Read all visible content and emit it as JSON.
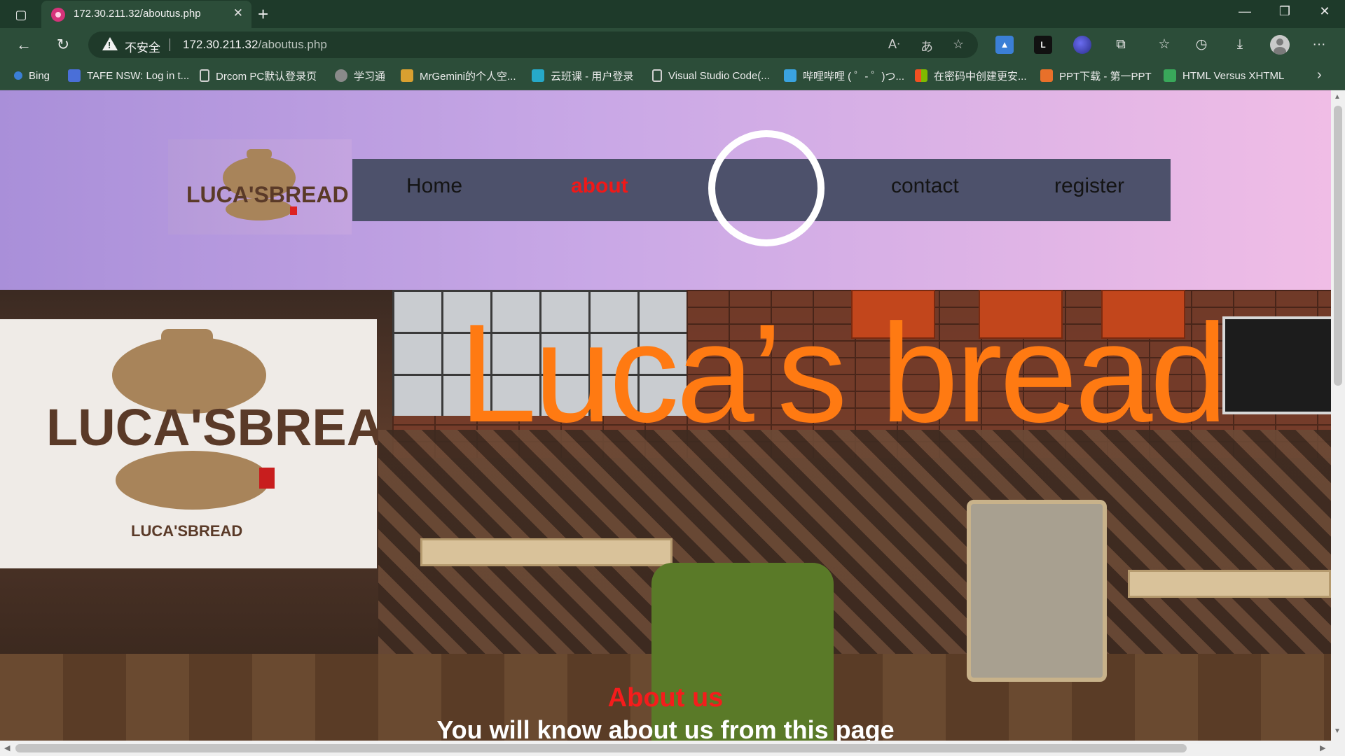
{
  "browser": {
    "tab": {
      "title": "172.30.211.32/aboutus.php",
      "close": "✕"
    },
    "new_tab": "+",
    "window_controls": {
      "minimize": "—",
      "restore": "❐",
      "close": "✕"
    },
    "toolbar": {
      "back": "←",
      "reload": "↻",
      "security_label": "不安全",
      "url_host": "172.30.211.32",
      "url_path": "/aboutus.php",
      "read_aloud": "A͏ᐧ",
      "translate": "あ",
      "favorite_add": "☆",
      "ext_dark_label": "L",
      "more": "···"
    },
    "bookmarks": [
      {
        "label": "Bing",
        "icon": "search-icon",
        "color": "#3b7fd6"
      },
      {
        "label": "TAFE NSW: Log in t...",
        "icon": "tafe-icon",
        "color": "#4a6fd8"
      },
      {
        "label": "Drcom PC默认登录页",
        "icon": "page-icon",
        "color": "#cfcfcf"
      },
      {
        "label": "学习通",
        "icon": "globe-icon",
        "color": "#8a8a8a"
      },
      {
        "label": "MrGemini的个人空...",
        "icon": "shield-icon",
        "color": "#d9a030"
      },
      {
        "label": "云班课 - 用户登录",
        "icon": "cloud-icon",
        "color": "#26a9c9"
      },
      {
        "label": "Visual Studio Code(...",
        "icon": "page-icon",
        "color": "#cfcfcf"
      },
      {
        "label": "哔哩哔哩 ( ゜- ゜)つ...",
        "icon": "bilibili-icon",
        "color": "#3aa3e0"
      },
      {
        "label": "在密码中创建更安...",
        "icon": "microsoft-icon",
        "color": "#f25022"
      },
      {
        "label": "PPT下载 - 第一PPT",
        "icon": "ppt-icon",
        "color": "#e8702a"
      },
      {
        "label": "HTML Versus XHTML",
        "icon": "w3-icon",
        "color": "#39a85a"
      }
    ]
  },
  "site": {
    "logo_text": "LUCA'SBREAD",
    "nav": [
      {
        "label": "Home",
        "active": false
      },
      {
        "label": "about",
        "active": true
      },
      {
        "label": "contact",
        "active": false
      },
      {
        "label": "register",
        "active": false
      }
    ],
    "hero": {
      "title": "Luca’s bread",
      "logo_caption": "LUCA'SBREAD",
      "about_heading": "About us",
      "about_subtitle": "You will know about us from this page"
    }
  },
  "colors": {
    "active_nav": "#f01818",
    "hero_title": "#ff7a12",
    "navbar_bg": "#4d516b",
    "logo_brown": "#5a3a28",
    "pot_tan": "#a8845a"
  }
}
